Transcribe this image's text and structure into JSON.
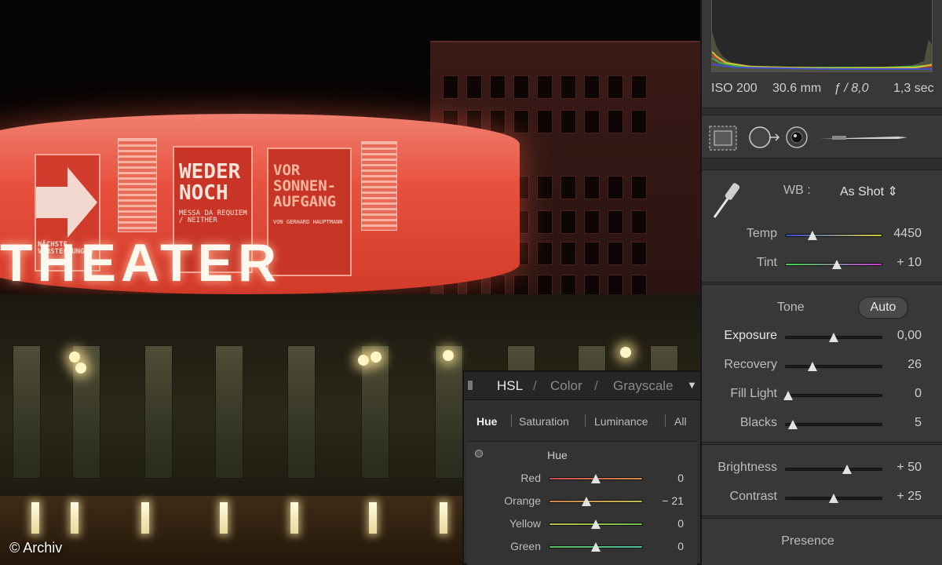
{
  "photo": {
    "sign_text": "THEATER",
    "poster_left_lines": [
      "NÄCHSTE",
      "VORSTELLUNGEN"
    ],
    "poster_mid_title": "WEDER NOCH",
    "poster_mid_sub": "MESSA DA REQUIEM / NEITHER",
    "poster_right_title": "VOR SONNEN-AUFGANG",
    "poster_right_sub": "VON GERHARD HAUPTMANN",
    "copyright": "© Archiv"
  },
  "histogram": {
    "iso": "ISO 200",
    "focal": "30.6 mm",
    "aperture": "ƒ / 8,0",
    "shutter": "1,3 sec"
  },
  "tools": {
    "items": [
      "crop-overlay",
      "spot-removal",
      "red-eye",
      "adjustment-brush"
    ]
  },
  "basic": {
    "wb_label": "WB :",
    "wb_value": "As Shot ⇕",
    "sliders": [
      {
        "label": "Temp",
        "value": "4450",
        "level": 0.28
      },
      {
        "label": "Tint",
        "value": "+ 10",
        "level": 0.53
      }
    ],
    "tone_label": "Tone",
    "auto_label": "Auto",
    "tone_sliders": [
      {
        "label": "Exposure",
        "value": "0,00",
        "level": 0.5
      },
      {
        "label": "Recovery",
        "value": "26",
        "level": 0.28
      },
      {
        "label": "Fill Light",
        "value": "0",
        "level": 0.03
      },
      {
        "label": "Blacks",
        "value": "5",
        "level": 0.08
      }
    ],
    "presence_sliders": [
      {
        "label": "Brightness",
        "value": "+ 50",
        "level": 0.64
      },
      {
        "label": "Contrast",
        "value": "+ 25",
        "level": 0.5
      }
    ],
    "presence_label": "Presence"
  },
  "hsl": {
    "tabs": [
      "HSL",
      "Color",
      "Grayscale"
    ],
    "tab_sep": "/",
    "collapse_glyph": "▼",
    "subtabs": [
      "Hue",
      "Saturation",
      "Luminance",
      "All"
    ],
    "group_title": "Hue",
    "rows": [
      {
        "label": "Red",
        "value": "0",
        "level": 0.5
      },
      {
        "label": "Orange",
        "value": "− 21",
        "level": 0.4
      },
      {
        "label": "Yellow",
        "value": "0",
        "level": 0.5
      },
      {
        "label": "Green",
        "value": "0",
        "level": 0.5
      }
    ]
  },
  "colors": {
    "panel_bg": "#383838",
    "theater_glow": "#e8503e",
    "temp_track": [
      "#3a4bd6",
      "#d6cf3a"
    ],
    "tint_track": [
      "#3ed64f",
      "#c63ad6"
    ]
  }
}
